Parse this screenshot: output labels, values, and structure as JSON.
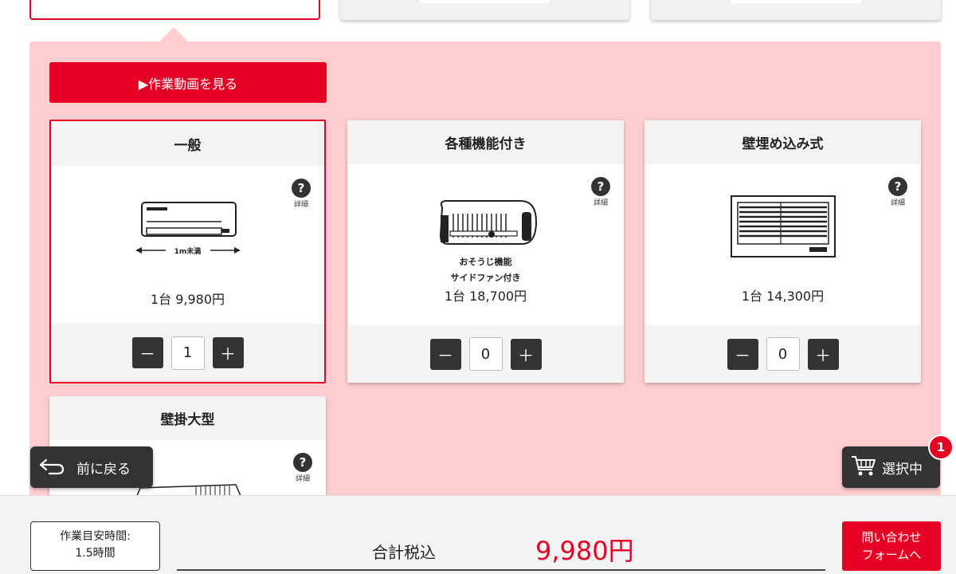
{
  "colors": {
    "accent": "#e60023",
    "panel_bg": "#ffcdd0",
    "dark": "#333333"
  },
  "video_button": {
    "label": "▶作業動画を見る"
  },
  "products": [
    {
      "title": "一般",
      "price": "1台 9,980円",
      "quantity": "1",
      "selected": true,
      "illustration": "standard-aircon",
      "dimension_label": "1m未満",
      "help_label": "詳細",
      "minus": "－",
      "plus": "＋"
    },
    {
      "title": "各種機能付き",
      "price": "1台 18,700円",
      "quantity": "0",
      "selected": false,
      "illustration": "function-aircon",
      "captions": [
        "おそうじ機能",
        "サイドファン付き"
      ],
      "help_label": "詳細",
      "minus": "－",
      "plus": "＋"
    },
    {
      "title": "壁埋め込み式",
      "price": "1台 14,300円",
      "quantity": "0",
      "selected": false,
      "illustration": "builtin-aircon",
      "help_label": "詳細",
      "minus": "－",
      "plus": "＋"
    },
    {
      "title": "壁掛大型",
      "help_label": "詳細",
      "illustration": "large-aircon"
    }
  ],
  "back_button": {
    "label": "前に戻る",
    "icon": "back-arrow-icon"
  },
  "cart_button": {
    "label": "選択中",
    "icon": "cart-icon",
    "badge": "1"
  },
  "footer": {
    "time_label": "作業目安時間:",
    "time_value": "1.5時間",
    "total_label": "合計税込",
    "total_value": "9,980円",
    "contact_line1": "問い合わせ",
    "contact_line2": "フォームへ"
  }
}
